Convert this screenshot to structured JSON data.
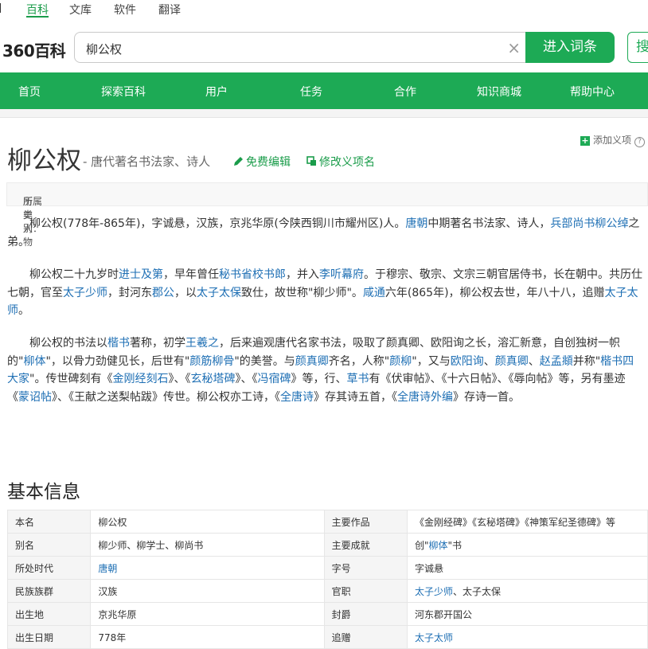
{
  "top_nav": {
    "items": [
      {
        "label": "百科",
        "active": true
      },
      {
        "label": "文库",
        "active": false
      },
      {
        "label": "软件",
        "active": false
      },
      {
        "label": "翻译",
        "active": false
      }
    ]
  },
  "logo": {
    "text": "360百科"
  },
  "search": {
    "value": "柳公权",
    "clear_icon": "×",
    "submit_label": "进入词条",
    "search_label": "搜"
  },
  "main_nav": {
    "items": [
      "首页",
      "探索百科",
      "用户",
      "任务",
      "合作",
      "知识商城",
      "帮助中心"
    ]
  },
  "entry": {
    "title": "柳公权",
    "subtitle": "- 唐代著名书法家、诗人",
    "edit_label": "免费编辑",
    "rename_label": "修改义项名",
    "add_sense_label": "添加义项",
    "category_label": "所属类别：",
    "category_value": "历史人物"
  },
  "paragraphs": {
    "p1": [
      {
        "t": "柳公权(778年-865年)，字诚悬，汉族，京兆华原(今陕西铜川市耀州区)人。"
      },
      {
        "t": "唐朝",
        "link": true
      },
      {
        "t": "中期著名书法家、诗人，"
      },
      {
        "t": "兵部尚书柳公绰",
        "link": true
      },
      {
        "t": "之弟。"
      }
    ],
    "p2": [
      {
        "t": "柳公权二十九岁时"
      },
      {
        "t": "进士及第",
        "link": true
      },
      {
        "t": "，早年曾任"
      },
      {
        "t": "秘书省校书郎",
        "link": true
      },
      {
        "t": "，并入"
      },
      {
        "t": "李听幕府",
        "link": true
      },
      {
        "t": "。于穆宗、敬宗、文宗三朝官居侍书，长在朝中。共历仕七朝，官至"
      },
      {
        "t": "太子少师",
        "link": true
      },
      {
        "t": "，封河东"
      },
      {
        "t": "郡公",
        "link": true
      },
      {
        "t": "，以"
      },
      {
        "t": "太子太保",
        "link": true
      },
      {
        "t": "致仕，故世称\"柳少师\"。"
      },
      {
        "t": "咸通",
        "link": true
      },
      {
        "t": "六年(865年)，柳公权去世，年八十八，追赠"
      },
      {
        "t": "太子太师",
        "link": true
      },
      {
        "t": "。"
      }
    ],
    "p3": [
      {
        "t": "柳公权的书法以"
      },
      {
        "t": "楷书",
        "link": true
      },
      {
        "t": "著称，初学"
      },
      {
        "t": "王羲之",
        "link": true
      },
      {
        "t": "，后来遍观唐代名家书法，吸取了颜真卿、欧阳询之长，溶汇新意，自创独树一帜的\""
      },
      {
        "t": "柳体",
        "link": true
      },
      {
        "t": "\"，以骨力劲健见长，后世有\""
      },
      {
        "t": "颜筋柳骨",
        "link": true
      },
      {
        "t": "\"的美誉。与"
      },
      {
        "t": "颜真卿",
        "link": true
      },
      {
        "t": "齐名，人称\""
      },
      {
        "t": "颜柳",
        "link": true
      },
      {
        "t": "\"，又与"
      },
      {
        "t": "欧阳询",
        "link": true
      },
      {
        "t": "、"
      },
      {
        "t": "颜真卿",
        "link": true
      },
      {
        "t": "、"
      },
      {
        "t": "赵孟頫",
        "link": true
      },
      {
        "t": "并称\""
      },
      {
        "t": "楷书四大家",
        "link": true
      },
      {
        "t": "\"。传世碑刻有《"
      },
      {
        "t": "金刚经刻石",
        "link": true
      },
      {
        "t": "》、《"
      },
      {
        "t": "玄秘塔碑",
        "link": true
      },
      {
        "t": "》、《"
      },
      {
        "t": "冯宿碑",
        "link": true
      },
      {
        "t": "》等，行、"
      },
      {
        "t": "草书",
        "link": true
      },
      {
        "t": "有《伏审帖》、《十六日帖》、《辱向帖》等，另有墨迹《"
      },
      {
        "t": "蒙诏帖",
        "link": true
      },
      {
        "t": "》、《王献之送梨帖跋》传世。柳公权亦工诗，《"
      },
      {
        "t": "全唐诗",
        "link": true
      },
      {
        "t": "》存其诗五首，《"
      },
      {
        "t": "全唐诗外编",
        "link": true
      },
      {
        "t": "》存诗一首。"
      }
    ]
  },
  "basic_info": {
    "title": "基本信息",
    "rows": [
      {
        "k1": "本名",
        "v1": [
          {
            "t": "柳公权"
          }
        ],
        "k2": "主要作品",
        "v2": [
          {
            "t": "《金刚经碑》《玄秘塔碑》《神策军纪圣德碑》等"
          }
        ]
      },
      {
        "k1": "别名",
        "v1": [
          {
            "t": "柳少师、柳学士、柳尚书"
          }
        ],
        "k2": "主要成就",
        "v2": [
          {
            "t": "创\""
          },
          {
            "t": "柳体",
            "link": true
          },
          {
            "t": "\"书"
          }
        ]
      },
      {
        "k1": "所处时代",
        "v1": [
          {
            "t": "唐朝",
            "link": true
          }
        ],
        "k2": "字号",
        "v2": [
          {
            "t": "字诚悬"
          }
        ]
      },
      {
        "k1": "民族族群",
        "v1": [
          {
            "t": "汉族"
          }
        ],
        "k2": "官职",
        "v2": [
          {
            "t": "太子少师",
            "link": true
          },
          {
            "t": "、太子太保"
          }
        ]
      },
      {
        "k1": "出生地",
        "v1": [
          {
            "t": "京兆华原"
          }
        ],
        "k2": "封爵",
        "v2": [
          {
            "t": "河东郡开国公"
          }
        ]
      },
      {
        "k1": "出生日期",
        "v1": [
          {
            "t": "778年"
          }
        ],
        "k2": "追赠",
        "v2": [
          {
            "t": "太子太师",
            "link": true
          }
        ]
      }
    ]
  },
  "colors": {
    "brand_green": "#1daa55",
    "link_blue": "#1e6fb4"
  }
}
